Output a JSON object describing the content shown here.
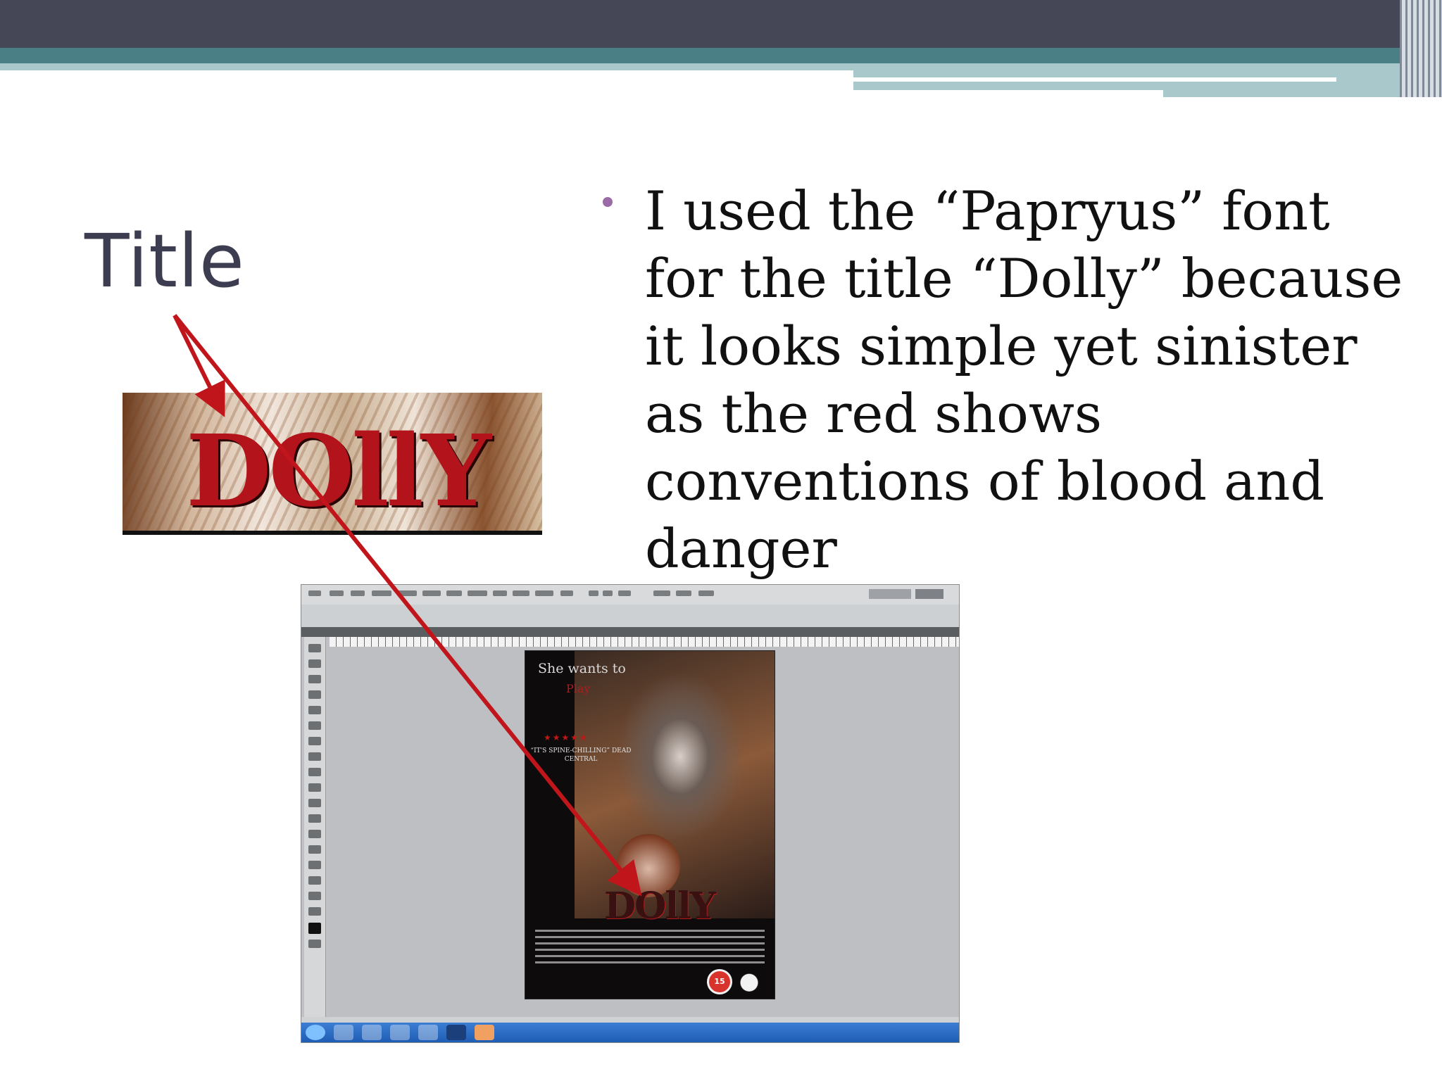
{
  "slide": {
    "title": "Title",
    "bullet": "I used the “Papryus” font for the title “Dolly” because it looks simple yet sinister as the red shows conventions of blood and danger"
  },
  "title_crop": {
    "word": "DOllY"
  },
  "poster": {
    "tagline_1": "She wants to",
    "tagline_2": "Play",
    "stars": "★★★★★",
    "quote": "“IT'S SPINE-CHILLING” DEAD CENTRAL",
    "title": "DOllY",
    "rating": "15"
  },
  "colors": {
    "header_dark": "#454656",
    "header_teal": "#4a7f86",
    "bullet": "#9b6ba6",
    "arrow": "#c0161b"
  }
}
